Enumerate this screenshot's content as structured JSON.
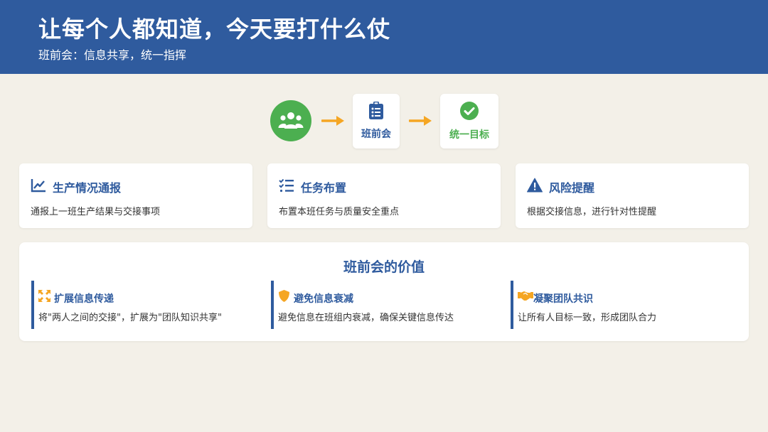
{
  "header": {
    "title": "让每个人都知道，今天要打什么仗",
    "subtitle": "班前会：信息共享，统一指挥"
  },
  "flow": {
    "step1_icon": "team-icon",
    "step2": {
      "label": "班前会",
      "icon": "clipboard-list-icon"
    },
    "step3": {
      "label": "统一目标",
      "icon": "check-circle-icon"
    }
  },
  "cards": [
    {
      "icon": "line-chart-icon",
      "title": "生产情况通报",
      "desc": "通报上一班生产结果与交接事项"
    },
    {
      "icon": "task-list-icon",
      "title": "任务布置",
      "desc": "布置本班任务与质量安全重点"
    },
    {
      "icon": "warning-icon",
      "title": "风险提醒",
      "desc": "根据交接信息，进行针对性提醒"
    }
  ],
  "value": {
    "title": "班前会的价值",
    "items": [
      {
        "icon": "expand-icon",
        "title": "扩展信息传递",
        "desc": "将\"两人之间的交接\"，扩展为\"团队知识共享\""
      },
      {
        "icon": "shield-icon",
        "title": "避免信息衰减",
        "desc": "避免信息在班组内衰减，确保关键信息传达"
      },
      {
        "icon": "handshake-icon",
        "title": "凝聚团队共识",
        "desc": "让所有人目标一致，形成团队合力"
      }
    ]
  },
  "colors": {
    "primary": "#2f5b9e",
    "green": "#4caf50",
    "orange": "#f5a623",
    "background": "#f3f0e8"
  }
}
